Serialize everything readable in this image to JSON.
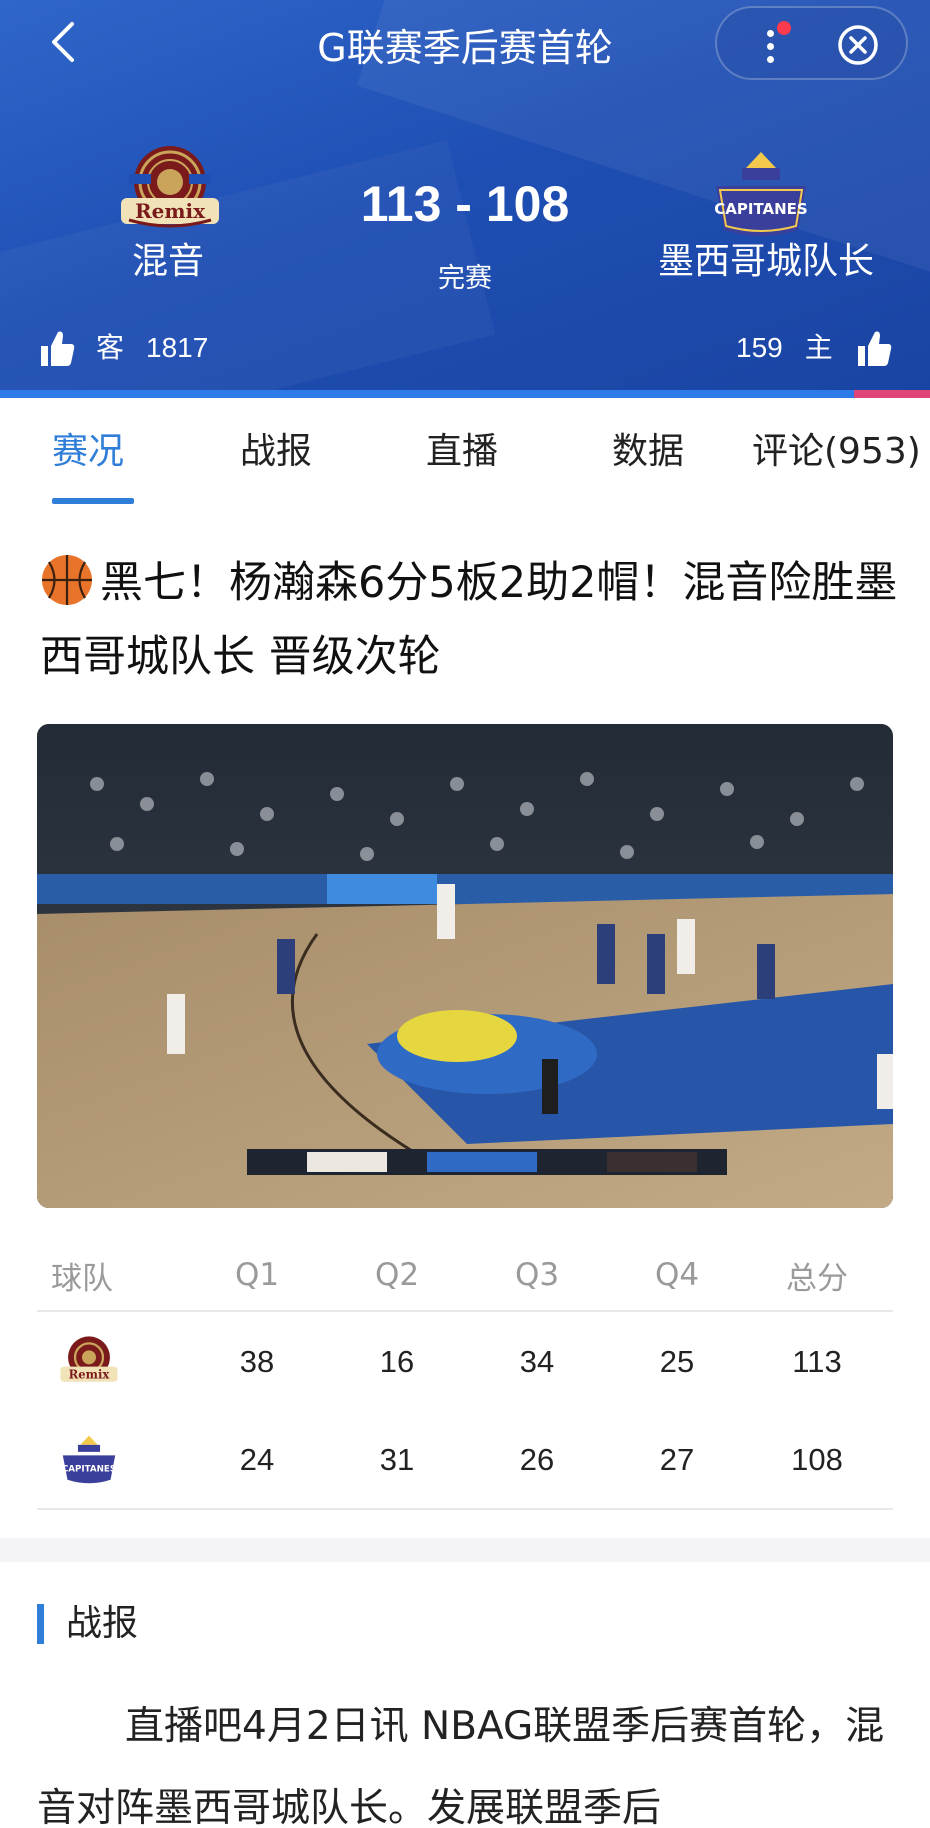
{
  "header": {
    "title": "G联赛季后赛首轮",
    "away": {
      "name": "混音",
      "logo_icon": "remix-logo",
      "side_label": "客",
      "likes": "1817"
    },
    "home": {
      "name": "墨西哥城队长",
      "logo_icon": "capitanes-logo",
      "side_label": "主",
      "likes": "159"
    },
    "score": "113 - 108",
    "status": "完赛"
  },
  "tabs": [
    {
      "label": "赛况",
      "active": true
    },
    {
      "label": "战报",
      "active": false
    },
    {
      "label": "直播",
      "active": false
    },
    {
      "label": "数据",
      "active": false
    },
    {
      "label": "评论(953)",
      "active": false
    }
  ],
  "headline": "黑七！杨瀚森6分5板2助2帽！混音险胜墨西哥城队长 晋级次轮",
  "boxscore": {
    "headers": [
      "球队",
      "Q1",
      "Q2",
      "Q3",
      "Q4",
      "总分"
    ],
    "rows": [
      {
        "team_icon": "remix-logo",
        "q1": "38",
        "q2": "16",
        "q3": "34",
        "q4": "25",
        "total": "113"
      },
      {
        "team_icon": "capitanes-logo",
        "q1": "24",
        "q2": "31",
        "q3": "26",
        "q4": "27",
        "total": "108"
      }
    ]
  },
  "report": {
    "section_title": "战报",
    "text": "直播吧4月2日讯 NBAG联盟季后赛首轮，混音对阵墨西哥城队长。发展联盟季后"
  },
  "colors": {
    "header_bg": "#1f4fb4",
    "accent": "#2f7ed8",
    "badge": "#ff3b4f"
  }
}
